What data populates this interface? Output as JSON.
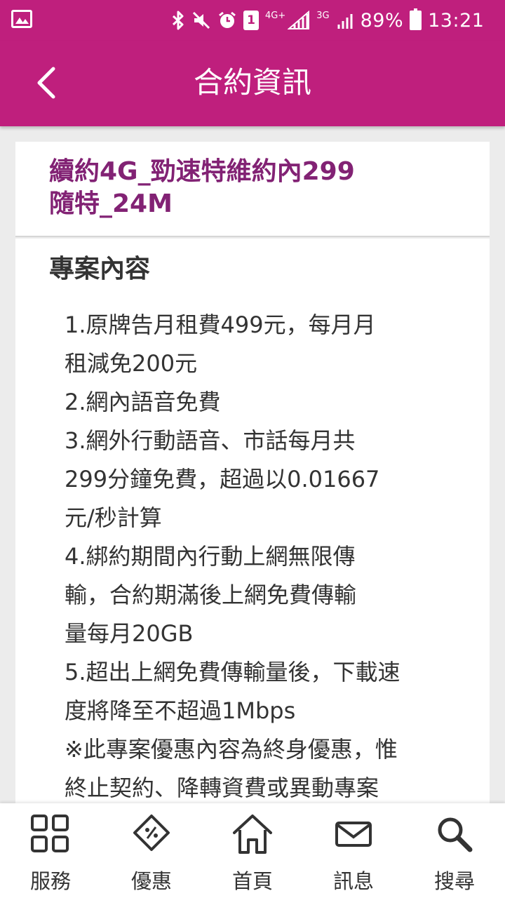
{
  "status_bar": {
    "network_4g": "4G+",
    "network_3g": "3G",
    "sim_slot": "1",
    "battery": "89%",
    "time": "13:21"
  },
  "header": {
    "title": "合約資訊"
  },
  "plan": {
    "title_line1": "續約4G_勁速特維約內299",
    "title_line2": "隨特_24M"
  },
  "content": {
    "section_title": "專案內容",
    "lines": [
      "1.原牌告月租費499元，每月月",
      "租減免200元",
      "2.網內語音免費",
      "3.網外行動語音、市話每月共",
      "299分鐘免費，超過以0.01667",
      "元/秒計算",
      "4.綁約期間內行動上網無限傳",
      "輸，合約期滿後上網免費傳輸",
      "量每月20GB",
      "5.超出上網免費傳輸量後，下載速",
      "度將降至不超過1Mbps",
      "※此專案優惠內容為終身優惠，惟",
      "終止契約、降轉資費或異動專案"
    ]
  },
  "bottom_nav": [
    {
      "label": "服務",
      "icon": "grid-icon"
    },
    {
      "label": "優惠",
      "icon": "discount-tag-icon"
    },
    {
      "label": "首頁",
      "icon": "home-icon"
    },
    {
      "label": "訊息",
      "icon": "mail-icon"
    },
    {
      "label": "搜尋",
      "icon": "search-icon"
    }
  ],
  "colors": {
    "brand": "#bf1f7d",
    "plan_title": "#822274",
    "text": "#333333",
    "background": "#ececec"
  }
}
